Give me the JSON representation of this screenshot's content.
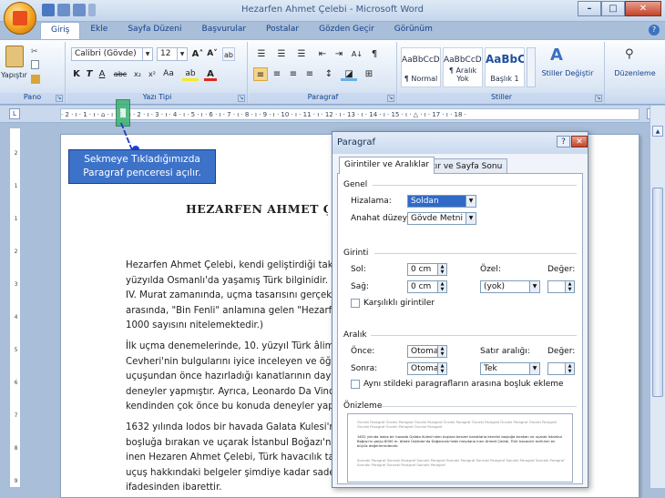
{
  "window": {
    "title": "Hezarfen Ahmet Çelebi - Microsoft Word"
  },
  "tabs": [
    "Giriş",
    "Ekle",
    "Sayfa Düzeni",
    "Başvurular",
    "Postalar",
    "Gözden Geçir",
    "Görünüm"
  ],
  "ribbon": {
    "clipboard": {
      "paste": "Yapıştır",
      "label": "Pano"
    },
    "font": {
      "name": "Calibri (Gövde)",
      "size": "12",
      "label": "Yazı Tipi"
    },
    "paragraph": {
      "label": "Paragraf"
    },
    "styles": {
      "items": [
        {
          "sample": "AaBbCcDc",
          "name": "¶ Normal"
        },
        {
          "sample": "AaBbCcDc",
          "name": "¶ Aralık Yok"
        },
        {
          "sample": "AaBbC",
          "name": "Başlık 1"
        }
      ],
      "change": "Stiller Değiştir",
      "label": "Stiller"
    },
    "editing": {
      "label": "Düzenleme"
    }
  },
  "ruler": {
    "ticks": "· 2 · ı · 1 · ı · ⌂ · ı · 1 · ı · 2 · ı · 3 · ı · 4 · ı · 5 · ı · 6 · ı · 7 · ı · 8 · ı · 9 · ı · 10 · ı · 11 · ı · 12 · ı · 13 · ı · 14 · ı · 15 · ı · △ · ı · 17 · ı · 18 ·"
  },
  "vruler": {
    "ticks": [
      "2",
      "1",
      "1",
      "2",
      "3",
      "4",
      "5",
      "6",
      "7",
      "8",
      "9",
      "10"
    ]
  },
  "callout": {
    "line1": "Sekmeye Tıkladığımızda",
    "line2": "Paragraf penceresi açılır."
  },
  "document": {
    "title": "HEZARFEN AHMET Ç",
    "para1": [
      "Hezarfen Ahmet Çelebi, kendi geliştirdiği takm",
      "yüzyılda Osmanlı'da yaşamış Türk bilginidir. 1",
      "IV. Murat zamanında, uçma tasarısını gerçekle",
      "arasında, \"Bin Fenli\" anlamına gelen \"Hezarfe",
      "1000 sayısını nitelemektedir.)"
    ],
    "para2": [
      "İlk uçma denemelerinde, 10. yüzyıl Türk âliml",
      "Cevheri'nin bulgularını iyice inceleyen ve öğre",
      "uçuşundan önce hazırladığı kanatlarının dayan",
      "deneyler yapmıştır. Ayrıca, Leonardo Da Vinci",
      "kendinden çok önce bu konuda deneyler yapa"
    ],
    "para3": [
      "1632 yılında lodos bir havada Galata Kulesi'nd",
      "boşluğa bırakan ve uçarak İstanbul Boğazı'nı g",
      "inen Hezaren Ahmet Çelebi, Türk havacılık tar",
      "uçuş hakkındaki belgeler şimdiye kadar sadec",
      "ifadesinden ibarettir."
    ]
  },
  "dialog": {
    "title": "Paragraf",
    "tabs": [
      "Girintiler ve Aralıklar",
      "Satır ve Sayfa Sonu"
    ],
    "general": {
      "section": "Genel",
      "alignment_label": "Hizalama:",
      "alignment": "Soldan",
      "outline_label": "Anahat düzeyi:",
      "outline": "Gövde Metni"
    },
    "indent": {
      "section": "Girinti",
      "left_label": "Sol:",
      "left": "0 cm",
      "right_label": "Sağ:",
      "right": "0 cm",
      "special_label": "Özel:",
      "special": "(yok)",
      "by_label": "Değer:",
      "mirror": "Karşılıklı girintiler"
    },
    "spacing": {
      "section": "Aralık",
      "before_label": "Önce:",
      "before": "Otomatik",
      "after_label": "Sonra:",
      "after": "Otomatik",
      "line_label": "Satır aralığı:",
      "line": "Tek",
      "at_label": "Değer:",
      "no_space": "Aynı stildeki paragrafların arasına boşluk ekleme"
    },
    "preview": {
      "section": "Önizleme",
      "prev": "Önceki Paragraf Önceki Paragraf Önceki Paragraf Önceki Paragraf Önceki Paragraf Önceki Paragraf Önceki Paragraf Önceki Paragraf Önceki Paragraf Önceki Paragraf",
      "main": "1632 yılında lodos bir havada Galata Kulesi'nden kuşlara benzer kanatlarla kendini boşluğa bırakan ve uçarak İstanbul Boğazı'nı geçip 6000 m. ötede Üsküdar'da Doğancılar'daki meydana inen Ahmet Çelebi, Türk havacılık tarihinin en büyük değerlerindendir.",
      "next": "Sonraki Paragraf Sonraki Paragraf Sonraki Paragraf Sonraki Paragraf Sonraki Paragraf Sonraki Paragraf Sonraki Paragraf Sonraki Paragraf Sonraki Paragraf Sonraki Paragraf"
    }
  }
}
